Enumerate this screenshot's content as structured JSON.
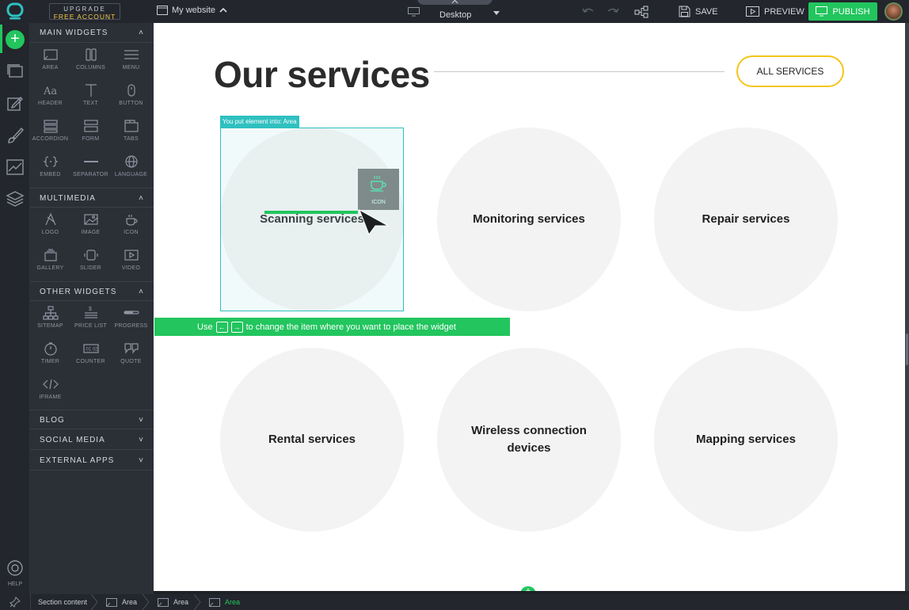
{
  "topbar": {
    "upgrade_line1": "UPGRADE",
    "upgrade_line2": "FREE ACCOUNT",
    "site_name": "My website",
    "device": "Desktop",
    "save": "SAVE",
    "preview": "PREVIEW",
    "publish": "PUBLISH"
  },
  "rail": {
    "help": "HELP"
  },
  "panel": {
    "main_widgets": {
      "title": "MAIN WIDGETS",
      "items": [
        "AREA",
        "COLUMNS",
        "MENU",
        "HEADER",
        "TEXT",
        "BUTTON",
        "ACCORDION",
        "FORM",
        "TABS",
        "EMBED",
        "SEPARATOR",
        "LANGUAGE"
      ]
    },
    "multimedia": {
      "title": "MULTIMEDIA",
      "items": [
        "LOGO",
        "IMAGE",
        "ICON",
        "GALLERY",
        "SLIDER",
        "VIDEO"
      ]
    },
    "other_widgets": {
      "title": "OTHER WIDGETS",
      "items": [
        "SITEMAP",
        "PRICE LIST",
        "PROGRESS",
        "TIMER",
        "COUNTER",
        "QUOTE",
        "IFRAME"
      ]
    },
    "collapsed": [
      "BLOG",
      "SOCIAL MEDIA",
      "EXTERNAL APPS"
    ]
  },
  "canvas": {
    "title": "Our services",
    "all_services": "ALL SERVICES",
    "drop_tag": "You put element into: Area",
    "ghost_label": "ICON",
    "hint_prefix": "Use",
    "hint_suffix": "to change the item where you want to place the widget",
    "services": [
      "Scanning services",
      "Monitoring services",
      "Repair services",
      "Rental services",
      "Wireless connection devices",
      "Mapping services"
    ]
  },
  "breadcrumb": [
    "Section content",
    "Area",
    "Area",
    "Area"
  ],
  "colors": {
    "accent": "#22c55e",
    "highlight": "#2fc0c0",
    "button_border": "#f5c518"
  }
}
